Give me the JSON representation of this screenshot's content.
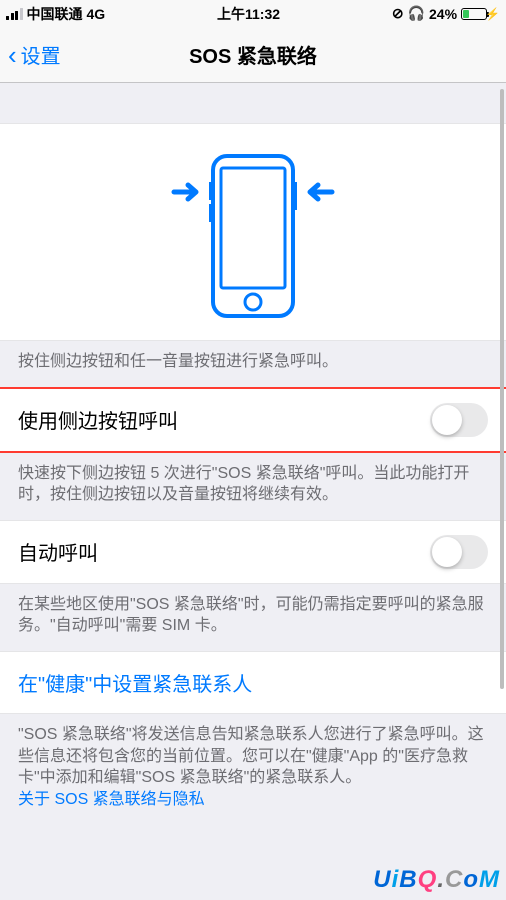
{
  "statusBar": {
    "carrier": "中国联通",
    "network": "4G",
    "time": "上午11:32",
    "batteryPercent": "24%"
  },
  "nav": {
    "back": "设置",
    "title": "SOS 紧急联络"
  },
  "illustrationFooter": "按住侧边按钮和任一音量按钮进行紧急呼叫。",
  "row1": {
    "label": "使用侧边按钮呼叫"
  },
  "row1Footer": "快速按下侧边按钮 5 次进行\"SOS 紧急联络\"呼叫。当此功能打开时，按住侧边按钮以及音量按钮将继续有效。",
  "row2": {
    "label": "自动呼叫"
  },
  "row2Footer": "在某些地区使用\"SOS 紧急联络\"时，可能仍需指定要呼叫的紧急服务。\"自动呼叫\"需要 SIM 卡。",
  "linkRow": "在\"健康\"中设置紧急联系人",
  "linkFooter": "\"SOS 紧急联络\"将发送信息告知紧急联系人您进行了紧急呼叫。这些信息还将包含您的当前位置。您可以在\"健康\"App 的\"医疗急救卡\"中添加和编辑\"SOS 紧急联络\"的紧急联系人。",
  "privacyLink": "关于 SOS 紧急联络与隐私",
  "watermark": {
    "text": "UiBQ.CoM"
  }
}
